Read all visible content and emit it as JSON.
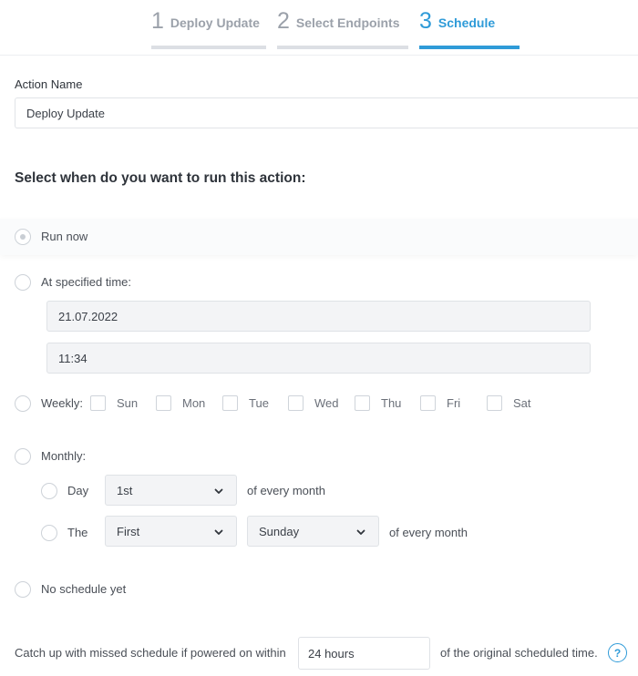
{
  "stepper": {
    "steps": [
      {
        "number": "1",
        "label": "Deploy Update"
      },
      {
        "number": "2",
        "label": "Select Endpoints"
      },
      {
        "number": "3",
        "label": "Schedule"
      }
    ],
    "active_step": 3
  },
  "action_name": {
    "label": "Action Name",
    "value": "Deploy Update"
  },
  "schedule": {
    "title": "Select when do you want to run this action:",
    "selected": "run_now",
    "run_now": "Run now",
    "specified_time": {
      "label": "At specified time:",
      "date": "21.07.2022",
      "time": "11:34"
    },
    "weekly": {
      "label": "Weekly:",
      "days": [
        "Sun",
        "Mon",
        "Tue",
        "Wed",
        "Thu",
        "Fri",
        "Sat"
      ]
    },
    "monthly": {
      "label": "Monthly:",
      "day_option": {
        "label": "Day",
        "value": "1st",
        "suffix": "of every month"
      },
      "the_option": {
        "label": "The",
        "ordinal": "First",
        "weekday": "Sunday",
        "suffix": "of every month"
      }
    },
    "no_schedule": "No schedule yet"
  },
  "catch_up": {
    "prefix": "Catch up with missed schedule if powered on within",
    "value": "24 hours",
    "suffix": "of the original scheduled time.",
    "help": "?"
  },
  "colors": {
    "accent": "#2f9bd8",
    "inactive": "#9ba1aa"
  }
}
